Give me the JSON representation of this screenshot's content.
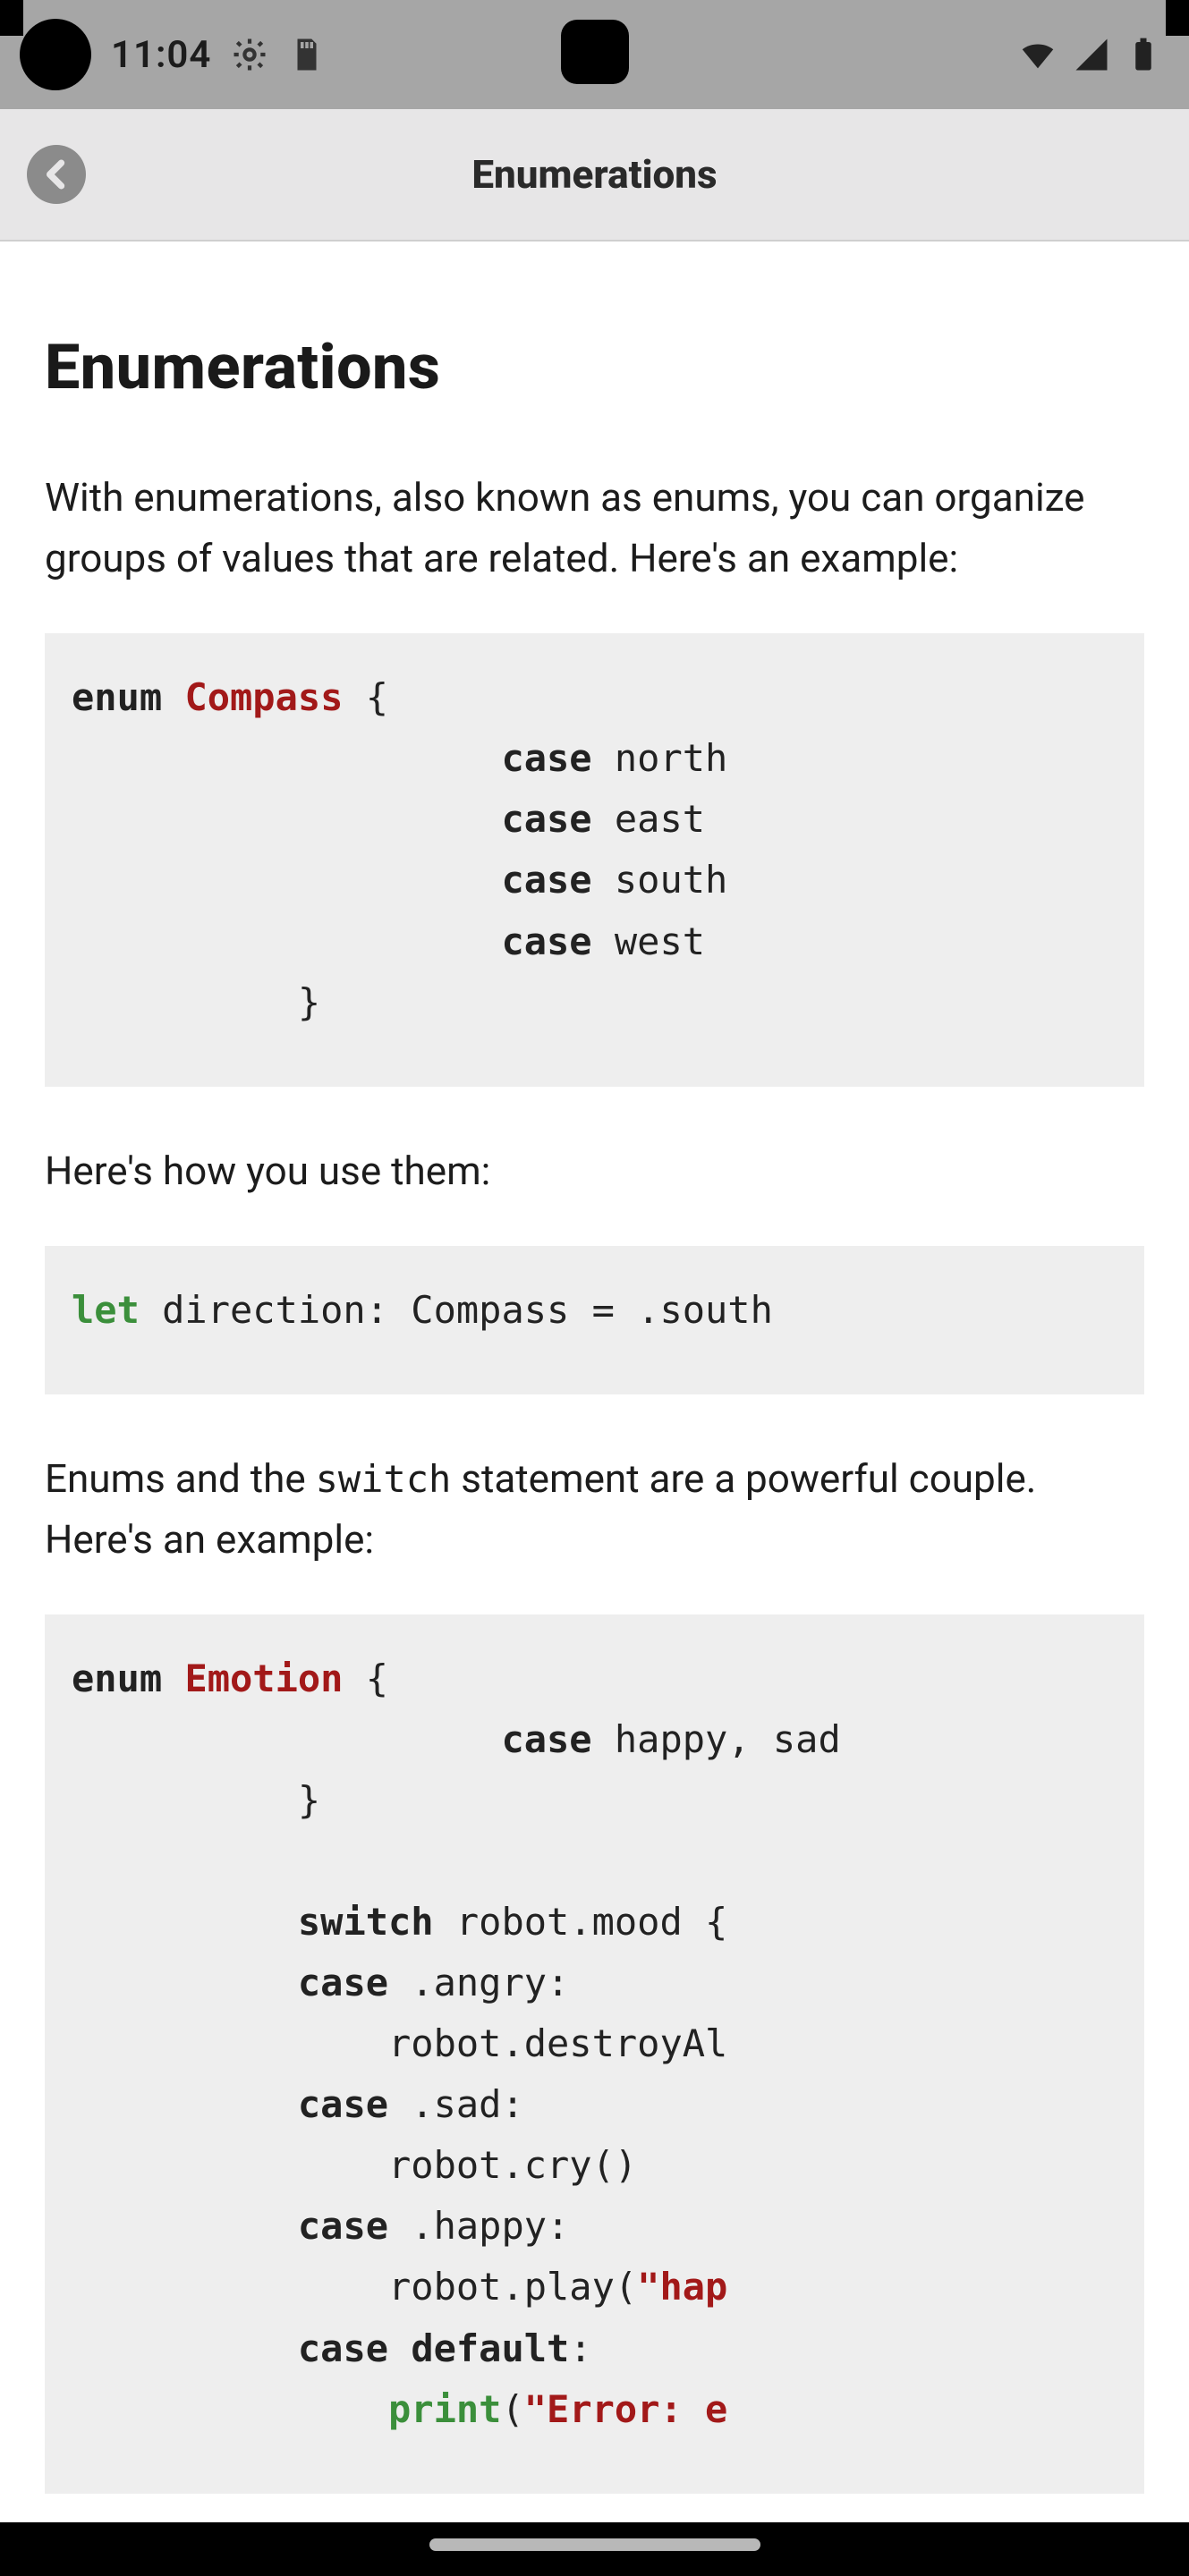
{
  "status": {
    "time": "11:04",
    "icons_left": [
      "gear-icon",
      "sd-card-icon"
    ],
    "icons_right": [
      "wifi-icon",
      "signal-icon",
      "battery-icon"
    ]
  },
  "app_bar": {
    "title": "Enumerations",
    "back_icon": "chevron-left-icon"
  },
  "page": {
    "heading": "Enumerations",
    "intro": "With enumerations, also known as enums, you can organize groups of values that are related. Here's an example:",
    "code1": {
      "l1_enum": "enum",
      "l1_type": "Compass",
      "l1_open": " {",
      "l2_case": "case",
      "l2_v": " north",
      "l3_case": "case",
      "l3_v": " east",
      "l4_case": "case",
      "l4_v": " south",
      "l5_case": "case",
      "l5_v": " west",
      "l6_close": "}"
    },
    "usage_para": "Here's how you use them:",
    "code2": {
      "let": "let",
      "rest": " direction: Compass = .south"
    },
    "couple_para_pre": "Enums and the ",
    "couple_para_mono": "switch",
    "couple_para_post": " statement are a powerful couple. Here's an example:",
    "code3": {
      "l1_enum": "enum",
      "l1_type": "Emotion",
      "l1_open": " {",
      "l2_case": "case",
      "l2_v": " happy, sad",
      "l3_close": "}",
      "l5_switch": "switch",
      "l5_v": " robot.mood {",
      "l6_case": "case",
      "l6_v": " .angry:",
      "l7_v": "    robot.destroyAl",
      "l8_case": "case",
      "l8_v": " .sad:",
      "l9_v": "    robot.cry()",
      "l10_case": "case",
      "l10_v": " .happy:",
      "l11_pre": "    robot.play(",
      "l11_str": "\"hap",
      "l12_case": "case",
      "l12_def": " default",
      "l12_col": ":",
      "l13_pre": "    ",
      "l13_fn": "print",
      "l13_par": "(",
      "l13_str": "\"Error: e"
    }
  }
}
